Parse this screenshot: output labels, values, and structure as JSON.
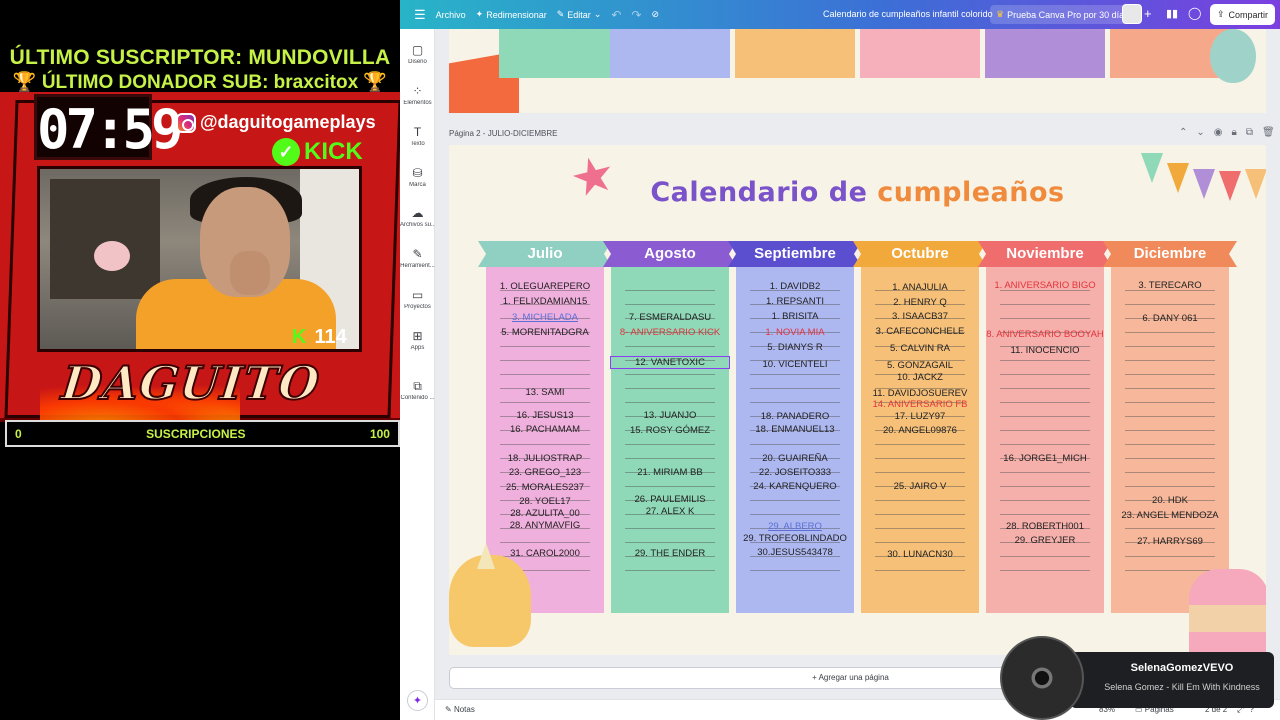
{
  "stream": {
    "last_subscriber": "ÚLTIMO SUSCRIPTOR: MUNDOVILLA",
    "last_donor": "🏆 ÚLTIMO DONADOR SUB: braxcitox 🏆",
    "timer": "07:59",
    "instagram": "@daguitogameplays",
    "kick_label": "KICK",
    "kick_badge": "K",
    "kick_count": "114",
    "brand": "DAGUITO",
    "goal_min": "0",
    "goal_label": "SUSCRIPCIONES",
    "goal_max": "100",
    "goal_progress": 0
  },
  "canva": {
    "topbar": {
      "archivo": "Archivo",
      "redimensionar": "Redimensionar",
      "editar": "Editar",
      "doc_title": "Calendario de cumpleaños infantil colorido",
      "pro_trial": "Prueba Canva Pro por 30 días",
      "share": "Compartir"
    },
    "sidebar": [
      {
        "icon": "layout-icon",
        "glyph": "▢",
        "label": "Diseño"
      },
      {
        "icon": "elements-icon",
        "glyph": "⁘",
        "label": "Elementos"
      },
      {
        "icon": "text-icon",
        "glyph": "T",
        "label": "Texto"
      },
      {
        "icon": "brand-icon",
        "glyph": "⛁",
        "label": "Marca"
      },
      {
        "icon": "uploads-icon",
        "glyph": "☁",
        "label": "Archivos su..."
      },
      {
        "icon": "draw-icon",
        "glyph": "✎",
        "label": "Herramient..."
      },
      {
        "icon": "projects-icon",
        "glyph": "▭",
        "label": "Proyectos"
      },
      {
        "icon": "apps-icon",
        "glyph": "⊞",
        "label": "Apps"
      },
      {
        "icon": "content-icon",
        "glyph": "⧉",
        "label": "Contenido ..."
      }
    ],
    "page_label": "Página 2 - JULIO-DICIEMBRE",
    "calendar": {
      "title_part1": "Calendario de",
      "title_part2": "cumpleaños",
      "months": [
        {
          "name": "Julio",
          "head_color": "#8fd0c2",
          "body_color": "#f0b0dd",
          "entries": [
            {
              "text": "1. OLEGUAREPERO",
              "style": ""
            },
            {
              "text": "1. FELIXDAMIAN15",
              "style": ""
            },
            {
              "text": "3. MICHELADA",
              "style": "blue"
            },
            {
              "text": "5. MORENITADGRA",
              "style": ""
            },
            {
              "text": "13. SAMI",
              "style": ""
            },
            {
              "text": "16. JESUS13",
              "style": ""
            },
            {
              "text": "16. PACHAMAM",
              "style": ""
            },
            {
              "text": "18. JULIOSTRAP",
              "style": ""
            },
            {
              "text": "23. GREGO_123",
              "style": ""
            },
            {
              "text": "25. MORALES237",
              "style": ""
            },
            {
              "text": "28. YOEL17",
              "style": ""
            },
            {
              "text": "28. AZULITA_00",
              "style": ""
            },
            {
              "text": "28. ANYMAVFIG",
              "style": ""
            },
            {
              "text": "31. CAROL2000",
              "style": ""
            }
          ]
        },
        {
          "name": "Agosto",
          "head_color": "#8a5bd1",
          "body_color": "#8fd8b8",
          "entries": [
            {
              "text": "7. ESMERALDASU",
              "style": ""
            },
            {
              "text": "8- ANIVERSARIO KICK",
              "style": "red"
            },
            {
              "text": "12. VANETOXIC",
              "style": "sel"
            },
            {
              "text": "13. JUANJO",
              "style": ""
            },
            {
              "text": "15. ROSY GÓMEZ",
              "style": ""
            },
            {
              "text": "21. MIRIAM BB",
              "style": ""
            },
            {
              "text": "26. PAULEMILIS",
              "style": ""
            },
            {
              "text": "27. ALEX K",
              "style": ""
            },
            {
              "text": "29. THE ENDER",
              "style": ""
            }
          ]
        },
        {
          "name": "Septiembre",
          "head_color": "#5b4fd0",
          "body_color": "#aeb8f0",
          "entries": [
            {
              "text": "1. DAVIDB2",
              "style": ""
            },
            {
              "text": "1. REPSANTI",
              "style": ""
            },
            {
              "text": "1. BRISITA",
              "style": ""
            },
            {
              "text": "1. NOVIA MIA",
              "style": "red"
            },
            {
              "text": "5. DIANYS R",
              "style": ""
            },
            {
              "text": "10. VICENTELI",
              "style": ""
            },
            {
              "text": "18. PANADERO",
              "style": ""
            },
            {
              "text": "18. ENMANUEL13",
              "style": ""
            },
            {
              "text": "20. GUAIREÑA",
              "style": ""
            },
            {
              "text": "22. JOSEITO333",
              "style": ""
            },
            {
              "text": "24. KARENQUERO",
              "style": ""
            },
            {
              "text": "29. ALBERO",
              "style": "blue"
            },
            {
              "text": "29. TROFEOBLINDADO",
              "style": ""
            },
            {
              "text": "30.JESUS543478",
              "style": ""
            }
          ]
        },
        {
          "name": "Octubre",
          "head_color": "#f2a93b",
          "body_color": "#f6c079",
          "entries": [
            {
              "text": "1. ANAJULIA",
              "style": ""
            },
            {
              "text": "2. HENRY Q",
              "style": ""
            },
            {
              "text": "3. ISAACB37",
              "style": ""
            },
            {
              "text": "3. CAFECONCHELE",
              "style": ""
            },
            {
              "text": "5. CALVIN RA",
              "style": ""
            },
            {
              "text": "5. GONZAGAIL",
              "style": ""
            },
            {
              "text": "10. JACKZ",
              "style": ""
            },
            {
              "text": "11. DAVIDJOSUEREV",
              "style": ""
            },
            {
              "text": "14. ANIVERSARIO FB",
              "style": "red"
            },
            {
              "text": "17. LUZY97",
              "style": ""
            },
            {
              "text": "20. ANGEL09876",
              "style": ""
            },
            {
              "text": "25. JAIRO V",
              "style": ""
            },
            {
              "text": "30. LUNACN30",
              "style": ""
            }
          ]
        },
        {
          "name": "Noviembre",
          "head_color": "#f06d6d",
          "body_color": "#f5b0ab",
          "entries": [
            {
              "text": "1. ANIVERSARIO BIGO",
              "style": "red"
            },
            {
              "text": "8. ANIVERSARIO BOOYAH",
              "style": "red"
            },
            {
              "text": "11. INOCENCIO",
              "style": ""
            },
            {
              "text": "16. JORGE1_MICH",
              "style": ""
            },
            {
              "text": "28. ROBERTH001",
              "style": ""
            },
            {
              "text": "29. GREYJER",
              "style": ""
            }
          ]
        },
        {
          "name": "Diciembre",
          "head_color": "#f08a5a",
          "body_color": "#f6b79a",
          "entries": [
            {
              "text": "3. TERECARO",
              "style": ""
            },
            {
              "text": "6. DANY 061",
              "style": ""
            },
            {
              "text": "20. HDK",
              "style": ""
            },
            {
              "text": "23. ANGEL MENDOZA",
              "style": ""
            },
            {
              "text": "27. HARRYS69",
              "style": ""
            }
          ]
        }
      ]
    },
    "add_page": "+ Agregar una página",
    "bottombar": {
      "notes": "Notas",
      "zoom": "83%",
      "pages": "Páginas",
      "page_count": "2 de 2"
    }
  },
  "music": {
    "artist": "SelenaGomezVEVO",
    "song": "Selena Gomez - Kill Em With Kindness"
  }
}
